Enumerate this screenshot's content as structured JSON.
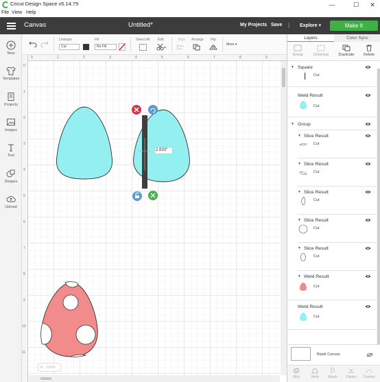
{
  "window": {
    "title": "Cricut Design Space  v5.14.79",
    "controls": [
      "—",
      "☐",
      "✕"
    ]
  },
  "menu": [
    "File",
    "View",
    "Help"
  ],
  "header": {
    "section": "Canvas",
    "doc_title": "Untitled*",
    "my_projects": "My Projects",
    "save": "Save",
    "separator": "|",
    "explore": "Explore",
    "explore_caret": "▾",
    "make_it": "Make It"
  },
  "left_tools": [
    "New",
    "Templates",
    "Projects",
    "Images",
    "Text",
    "Shapes",
    "Upload"
  ],
  "toolbar": {
    "linetype_label": "Linetype",
    "linetype_value": "Cut",
    "fill_label": "Fill",
    "fill_value": "No Fill",
    "select_all": "Select All",
    "edit": "Edit",
    "align": "Align",
    "arrange": "Arrange",
    "flip": "Flip",
    "more": "More ▾"
  },
  "canvas": {
    "ruler_top": [
      "0",
      "1",
      "2",
      "3",
      "4",
      "5",
      "6",
      "7",
      "8",
      "9"
    ],
    "ruler_left": [
      "0",
      "1",
      "2",
      "3",
      "4",
      "5",
      "6",
      "7",
      "8",
      "9",
      "10",
      "11"
    ],
    "dimension_label": "2.833\"",
    "zoom": "100%"
  },
  "right_panel": {
    "tabs": [
      "Layers",
      "Color Sync"
    ],
    "actions": [
      "Group",
      "UnGroup",
      "Duplicate",
      "Delete"
    ],
    "layers": [
      {
        "name": "Square",
        "sub": "Cut",
        "color": "#444444",
        "kind": "line"
      },
      {
        "name": "Weld Result",
        "sub": "Cut",
        "color": "#93eff0",
        "kind": "egg"
      },
      {
        "name": "Group",
        "sub": "",
        "color": "",
        "kind": "group"
      },
      {
        "name": "Slice Result",
        "sub": "Cut",
        "color": "#ffffff",
        "kind": "s1"
      },
      {
        "name": "Slice Result",
        "sub": "Cut",
        "color": "#ffffff",
        "kind": "s2"
      },
      {
        "name": "Slice Result",
        "sub": "Cut",
        "color": "#ffffff",
        "kind": "s3"
      },
      {
        "name": "Slice Result",
        "sub": "Cut",
        "color": "#ffffff",
        "kind": "s4"
      },
      {
        "name": "Slice Result",
        "sub": "Cut",
        "color": "#ffffff",
        "kind": "s5"
      },
      {
        "name": "Weld Result",
        "sub": "Cut",
        "color": "#f28b8b",
        "kind": "egg"
      },
      {
        "name": "Weld Result",
        "sub": "Cut",
        "color": "#93eff0",
        "kind": "egg"
      }
    ],
    "blank_canvas": "Blank Canvas",
    "bottom_actions": [
      "Slice",
      "Weld",
      "Attach",
      "Flatten",
      "Contour"
    ]
  },
  "colors": {
    "header_bg": "#3c3c3f",
    "make_it_green": "#3faf46",
    "egg_cyan": "#93eff0",
    "egg_pink": "#f28b8b"
  }
}
